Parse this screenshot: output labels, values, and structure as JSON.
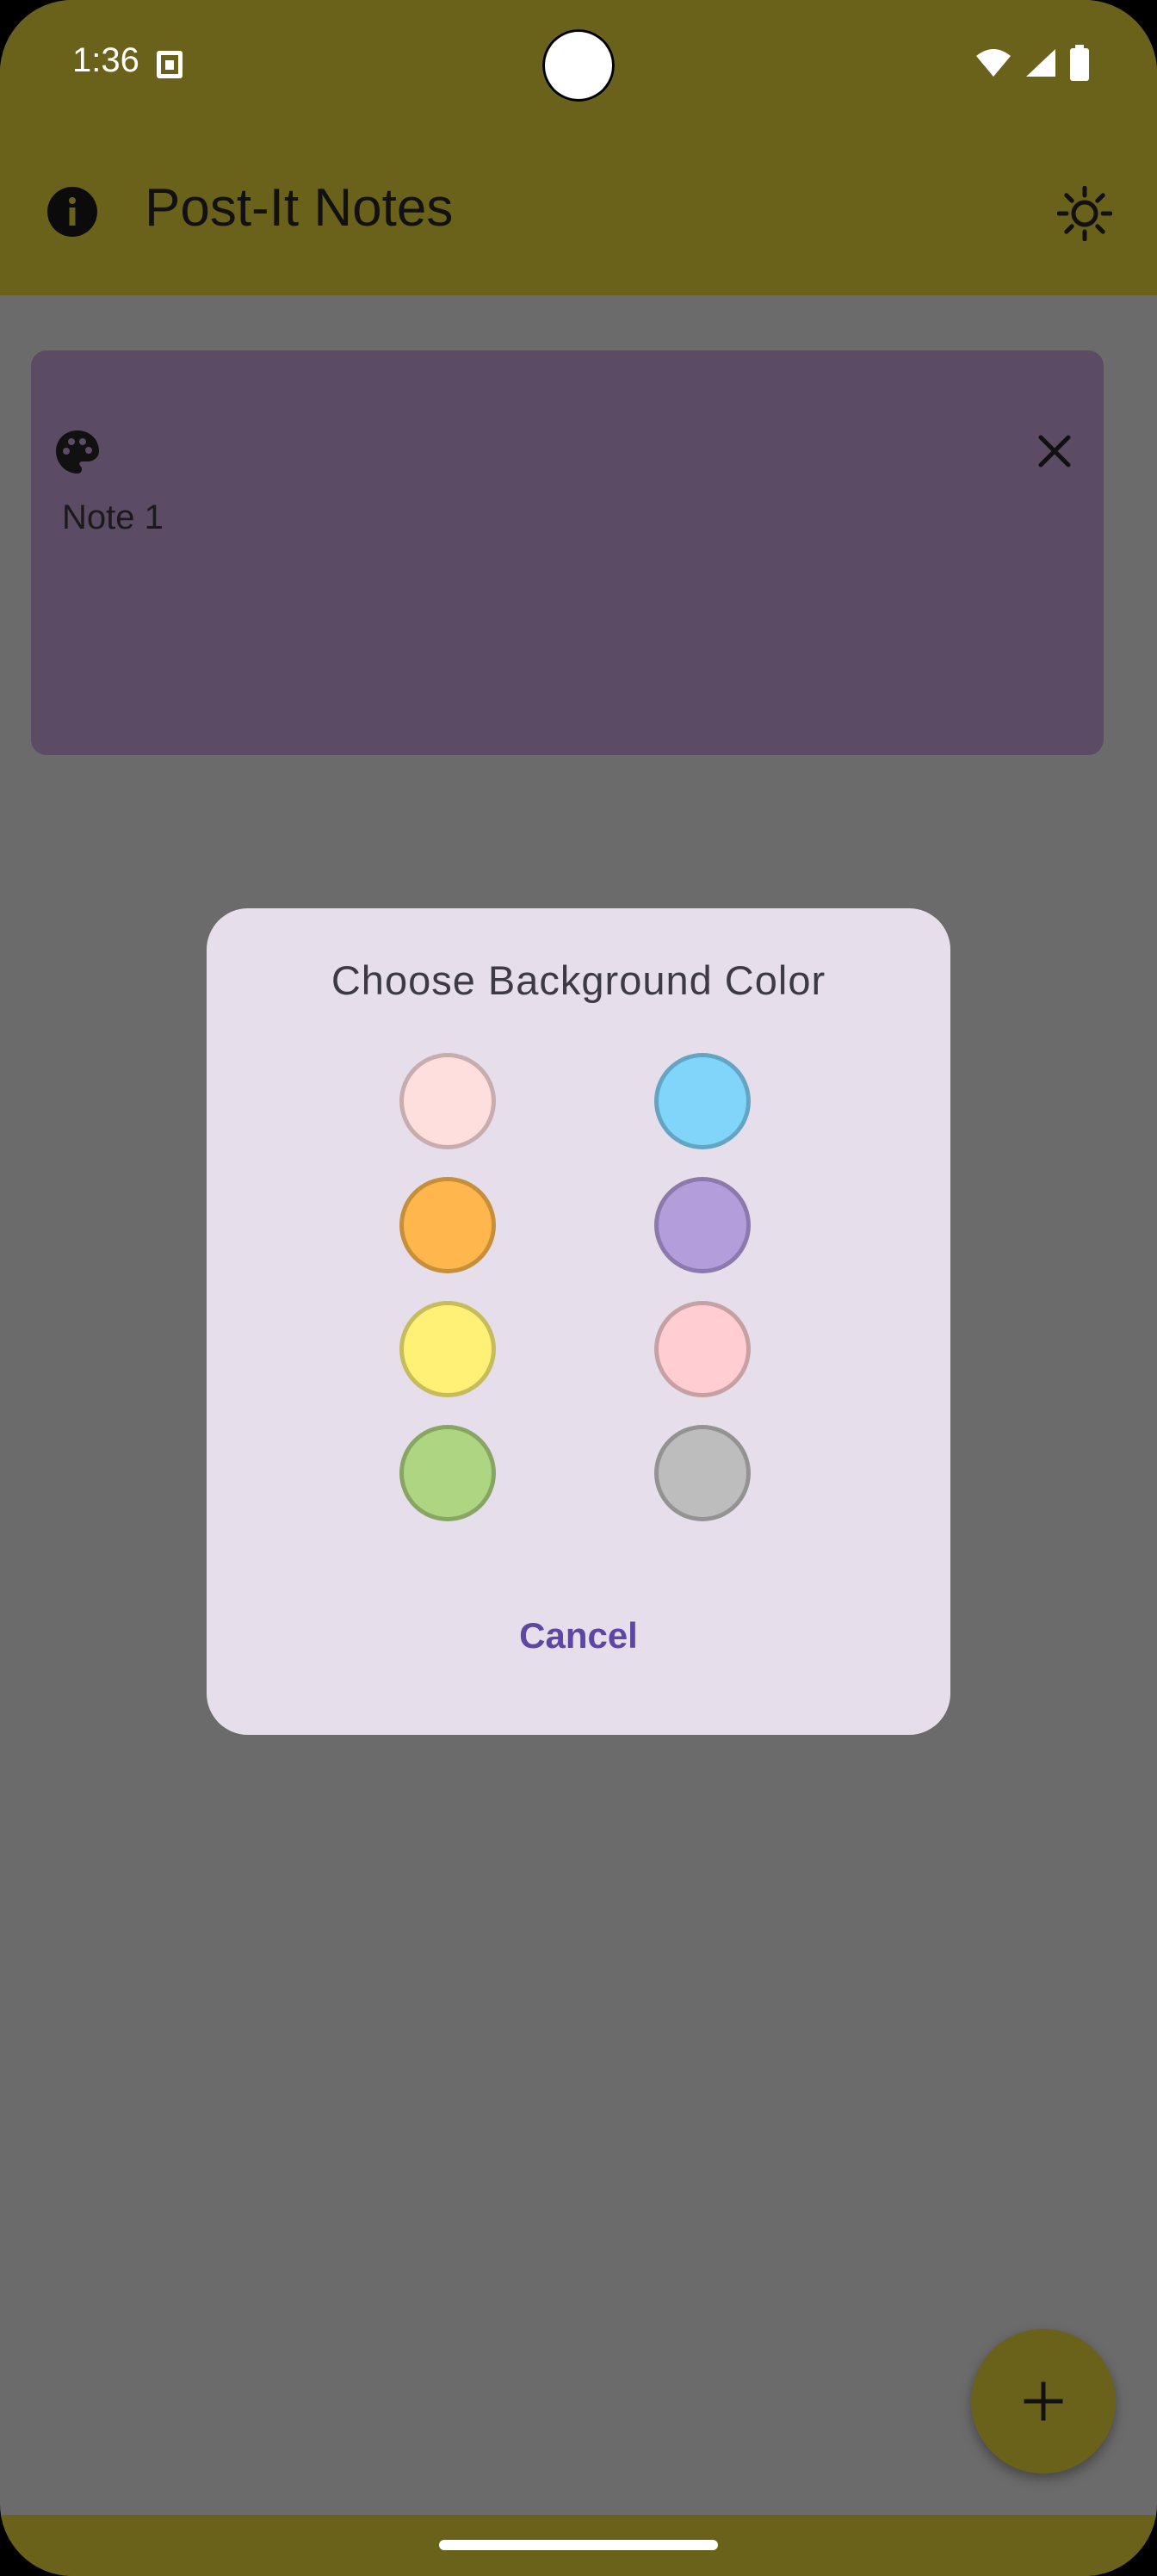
{
  "status_bar": {
    "time": "1:36"
  },
  "app_bar": {
    "title": "Post-It Notes",
    "info_icon": "info-icon",
    "theme_icon": "brightness-icon"
  },
  "notes": [
    {
      "text": "Note 1",
      "color": "#5c4b64"
    }
  ],
  "dialog": {
    "title": "Choose Background Color",
    "swatches": [
      {
        "color": "#ffdede"
      },
      {
        "color": "#81d4fa"
      },
      {
        "color": "#ffb74d"
      },
      {
        "color": "#b39ddb"
      },
      {
        "color": "#fff176"
      },
      {
        "color": "#ffcdd2"
      },
      {
        "color": "#aed581"
      },
      {
        "color": "#bdbdbd"
      }
    ],
    "cancel_label": "Cancel"
  },
  "colors": {
    "accent": "#6a621a",
    "scrim": "#6b6b6b",
    "dialog_bg": "#e6dfeb",
    "button_text": "#5b48a3"
  }
}
